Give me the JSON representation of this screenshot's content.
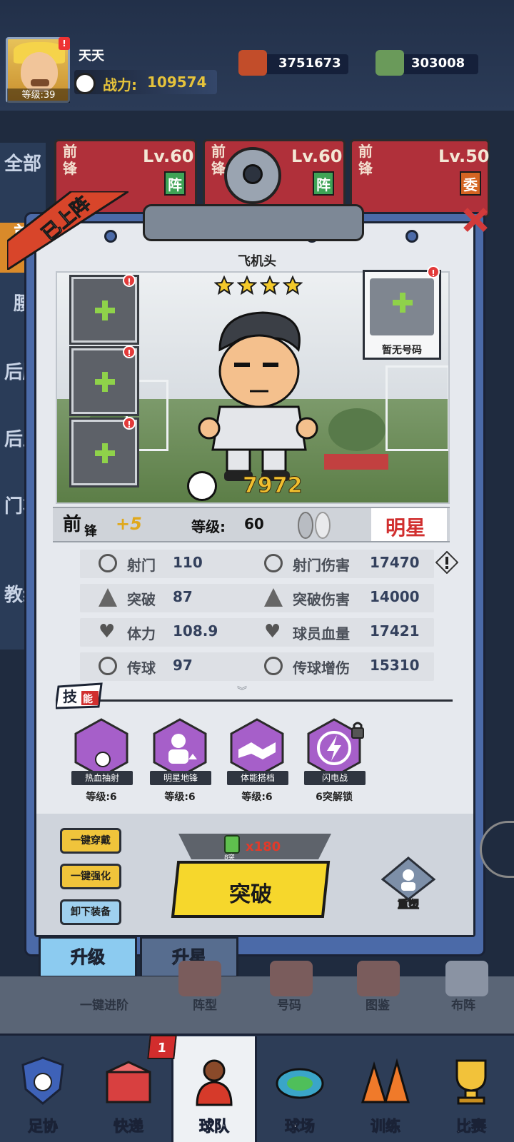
{
  "profile": {
    "name": "天天",
    "level_label": "等级:39",
    "power_label": "战力:",
    "power_value": "109574",
    "avatar_badge": "!"
  },
  "resources": [
    {
      "icon": "food-box-icon",
      "value": "3751673"
    },
    {
      "icon": "cash-icon",
      "value": "303008"
    }
  ],
  "left_nav": [
    "全部",
    "前",
    "腰",
    "后腰",
    "后卫",
    "门将",
    "教练"
  ],
  "bg_cards": [
    {
      "pos": "前锋",
      "level": "Lv.60",
      "tag": "阵"
    },
    {
      "pos": "前锋",
      "level": "Lv.60",
      "tag": "阵"
    },
    {
      "pos": "前锋",
      "level": "Lv.50",
      "tag": "委"
    }
  ],
  "ribbon_label": "已上阵",
  "hero": {
    "name": "飞机头",
    "stars": 4,
    "power": "7972"
  },
  "equip_slots": [
    {
      "alert": "!"
    },
    {
      "alert": "!"
    },
    {
      "alert": "!"
    }
  ],
  "jersey": {
    "label": "暂无号码",
    "alert": "!"
  },
  "info_bar": {
    "pos_top": "前",
    "pos_bottom": "锋",
    "plus": "+5",
    "level_label": "等级:",
    "level_value": "60",
    "rank_tag": "明星"
  },
  "stats": [
    {
      "name": "射门",
      "value": "110",
      "icon": "target-icon",
      "name2": "射门伤害",
      "value2": "17470",
      "icon2": "target-plus-icon"
    },
    {
      "name": "突破",
      "value": "87",
      "icon": "sprint-icon",
      "name2": "突破伤害",
      "value2": "14000",
      "icon2": "sprint-plus-icon"
    },
    {
      "name": "体力",
      "value": "108.9",
      "icon": "heart-icon",
      "name2": "球员血量",
      "value2": "17421",
      "icon2": "heart-plus-icon"
    },
    {
      "name": "传球",
      "value": "97",
      "icon": "pass-icon",
      "name2": "传球增伤",
      "value2": "15310",
      "icon2": "pass-plus-icon"
    }
  ],
  "skills_header": {
    "a": "技",
    "b": "能"
  },
  "skills": [
    {
      "name": "热血抽射",
      "level": "等级:6",
      "icon": "kick-icon"
    },
    {
      "name": "明星地锋",
      "level": "等级:6",
      "icon": "player-up-icon"
    },
    {
      "name": "体能搭档",
      "level": "等级:6",
      "icon": "handshake-icon"
    },
    {
      "name": "闪电战",
      "level": "6突解锁",
      "icon": "lightning-icon"
    }
  ],
  "actions": {
    "wear_all": "一键穿戴",
    "enhance_all": "一键强化",
    "unequip": "卸下装备",
    "cost": "x180",
    "cost_sub": "8突",
    "main": "突破",
    "reshape": "重塑"
  },
  "board_tabs": {
    "upgrade": "升级",
    "star": "升星"
  },
  "grey_toolbar": [
    "一键进阶",
    "阵型",
    "号码",
    "图鉴",
    "布阵"
  ],
  "bottom_nav": [
    {
      "label": "足协",
      "icon": "shield-ball-icon"
    },
    {
      "label": "快递",
      "icon": "parcel-icon",
      "badge": "1"
    },
    {
      "label": "球队",
      "icon": "player-icon"
    },
    {
      "label": "球场",
      "icon": "stadium-icon"
    },
    {
      "label": "训练",
      "icon": "cones-icon"
    },
    {
      "label": "比赛",
      "icon": "trophy-icon"
    }
  ],
  "colors": {
    "accent_yellow": "#f6d72c",
    "gold_text": "#f1bf2f",
    "brand_red": "#d12f2f",
    "board_blue": "#4b6aa8"
  }
}
